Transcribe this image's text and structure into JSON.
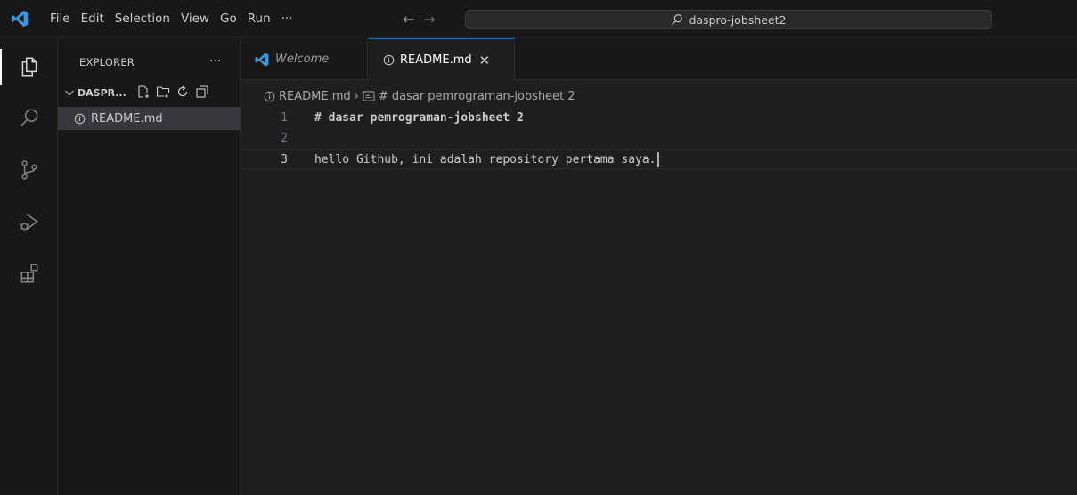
{
  "titlebar": {
    "menu": [
      "File",
      "Edit",
      "Selection",
      "View",
      "Go",
      "Run",
      "···"
    ],
    "back": "←",
    "forward": "→",
    "search": "daspro-jobsheet2"
  },
  "activity": [
    "explorer-icon",
    "search-icon",
    "source-control-icon",
    "run-debug-icon",
    "extensions-icon"
  ],
  "sidebar": {
    "title": "EXPLORER",
    "more": "···",
    "folder": "DASPR...",
    "file": "README.md"
  },
  "tabs": {
    "welcome": "Welcome",
    "readme": "README.md",
    "close": "✕"
  },
  "breadcrumb": {
    "file": "README.md",
    "sep": "›",
    "symbol": "# dasar pemrograman-jobsheet 2"
  },
  "editor": {
    "lines": [
      {
        "num": "1",
        "text": "# dasar pemrograman-jobsheet 2"
      },
      {
        "num": "2",
        "text": ""
      },
      {
        "num": "3",
        "text": "hello Github, ini adalah repository pertama saya."
      }
    ]
  },
  "colors": {
    "accent": "#0078d4",
    "heading": "#569cd6",
    "vscode_blue": "#3a96dd"
  }
}
